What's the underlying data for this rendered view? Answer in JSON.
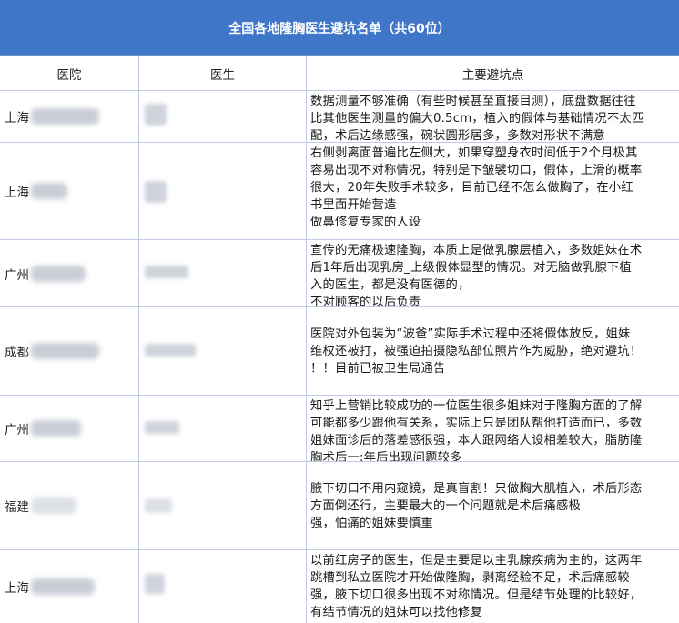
{
  "title": "全国各地隆胸医生避坑名单（共60位）",
  "columns": [
    "医院",
    "医生",
    "主要避坑点"
  ],
  "rows": [
    {
      "hospital": "上海",
      "issue_lines": [
        "数据测量不够准确（有些时候甚至直接目测），底盘数据往往",
        "比其他医生测量的偏大0.5cm，植入的假体与基础情况不太匹",
        "配，术后边缘感强，碗状圆形居多，多数对形状不满意"
      ]
    },
    {
      "hospital": "上海",
      "issue_lines": [
        "右侧剥离面普遍比左侧大，如果穿塑身衣时间低于2个月极其",
        "容易出现不对称情况，特别是下皱襞切口，假体，上滑的概率",
        "很大，20年失败手术较多，目前已经不怎么做胸了，在小红",
        "书里面开始营造",
        "做鼻修复专家的人设"
      ]
    },
    {
      "hospital": "广州",
      "issue_lines": [
        "宣传的无痛极速隆胸，本质上是做乳腺层植入，多数姐妹在术",
        "后1年后出现乳房_上级假体显型的情况。对无脑做乳腺下植",
        "入的医生，都是没有医德的，",
        "不对顾客的以后负责"
      ]
    },
    {
      "hospital": "成都",
      "issue_lines": [
        "医院对外包装为“波爸”实际手术过程中还将假体放反，姐妹",
        "维权还被打，被强迫拍摄隐私部位照片作为威胁，绝对避坑！",
        "！！目前已被卫生局通告"
      ]
    },
    {
      "hospital": "广州",
      "issue_lines": [
        "知乎上营销比较成功的一位医生很多姐妹对于隆胸方面的了解",
        "可能都多少跟他有关系，实际上只是团队帮他打造而已，多数",
        "姐妹面诊后的落差感很强，本人跟网络人设相差较大，脂肪隆",
        "胸术后一:年后出现问题较多"
      ]
    },
    {
      "hospital": "福建",
      "issue_lines": [
        "腋下切口不用内窥镜，是真盲割！只做胸大肌植入，术后形态",
        "方面倒还行，主要最大的一个问题就是术后痛感极",
        "强，怕痛的姐妹要慎重"
      ]
    },
    {
      "hospital": "上海",
      "issue_lines": [
        "以前红房子的医生，但是主要是以主乳腺疾病为主的，这两年",
        "跳槽到私立医院才开始做隆胸，剥离经验不足，术后痛感较",
        "强，腋下切口很多出现不对称情况。但是结节处理的比较好，",
        "有结节情况的姐妹可以找他修复"
      ]
    }
  ]
}
